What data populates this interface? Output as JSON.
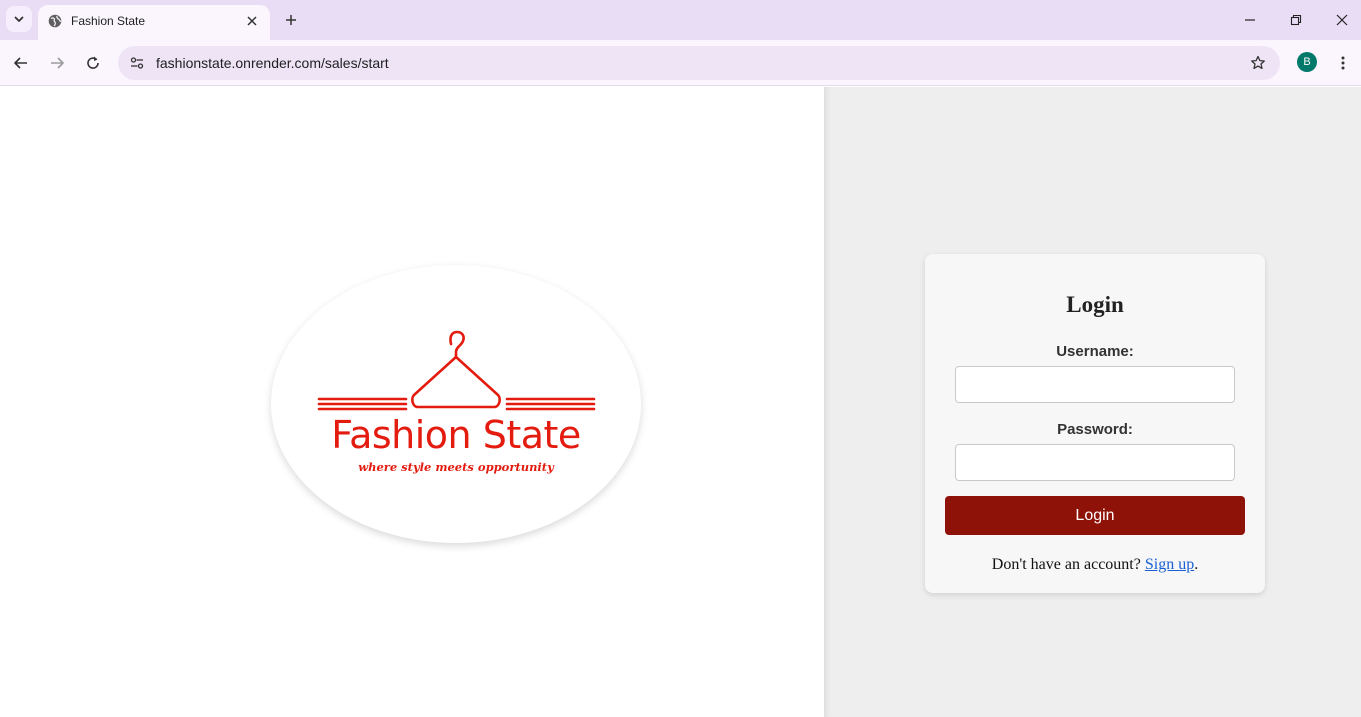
{
  "browser": {
    "tab_title": "Fashion State",
    "url": "fashionstate.onrender.com/sales/start",
    "profile_initial": "B"
  },
  "logo": {
    "name": "Fashion State",
    "tagline": "where style meets opportunity",
    "color": "#e41b0f"
  },
  "login": {
    "title": "Login",
    "username_label": "Username:",
    "username_value": "",
    "password_label": "Password:",
    "password_value": "",
    "button_label": "Login",
    "signup_prompt": "Don't have an account? ",
    "signup_link": "Sign up",
    "signup_suffix": ".",
    "button_color": "#8e1208"
  }
}
